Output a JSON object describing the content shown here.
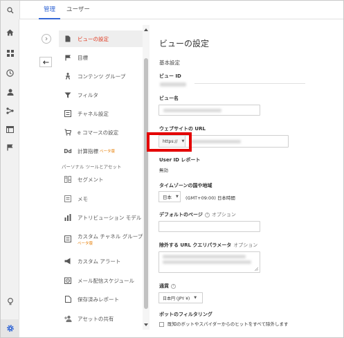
{
  "tabs": {
    "admin": "管理",
    "user": "ユーザー"
  },
  "nav": {
    "view_settings": "ビューの設定",
    "goals": "目標",
    "content_grouping": "コンテンツ グループ",
    "filters": "フィルタ",
    "channel_settings": "チャネル設定",
    "ecommerce_settings": "e コマースの設定",
    "calculated_metrics": "計算指標",
    "calculated_metrics_badge": "ベータ版",
    "personal_tools_header": "パーソナル ツールとアセット",
    "segments": "セグメント",
    "notes": "メモ",
    "attribution_models": "アトリビューション モデル",
    "custom_channel_grouping": "カスタム チャネル グループ",
    "custom_channel_grouping_badge": "ベータ版",
    "custom_alerts": "カスタム アラート",
    "scheduled_emails": "メール配信スケジュール",
    "saved_reports": "保存済みレポート",
    "share_assets": "アセットの共有"
  },
  "main": {
    "title": "ビューの設定",
    "basic_settings": "基本設定",
    "view_id_label": "ビュー ID",
    "view_name_label": "ビュー名",
    "website_url_label": "ウェブサイトの URL",
    "protocol_value": "https://",
    "user_id_label": "User ID レポート",
    "user_id_value": "無効",
    "timezone_label": "タイムゾーンの国や地域",
    "timezone_country": "日本",
    "timezone_value": "(GMT+09:00) 日本時間",
    "default_page_label": "デフォルトのページ",
    "optional": "オプション",
    "exclude_params_label": "除外する URL クエリパラメータ",
    "currency_label": "通貨",
    "currency_value": "日本円 (JPY ¥)",
    "bot_filter_label": "ボットのフィルタリング",
    "bot_filter_checkbox": "既知のボットやスパイダーからのヒットをすべて除外します"
  },
  "colors": {
    "accent": "#3367d6",
    "active_nav": "#e03b22",
    "highlight_box": "#e40000",
    "beta": "#e67c00"
  }
}
